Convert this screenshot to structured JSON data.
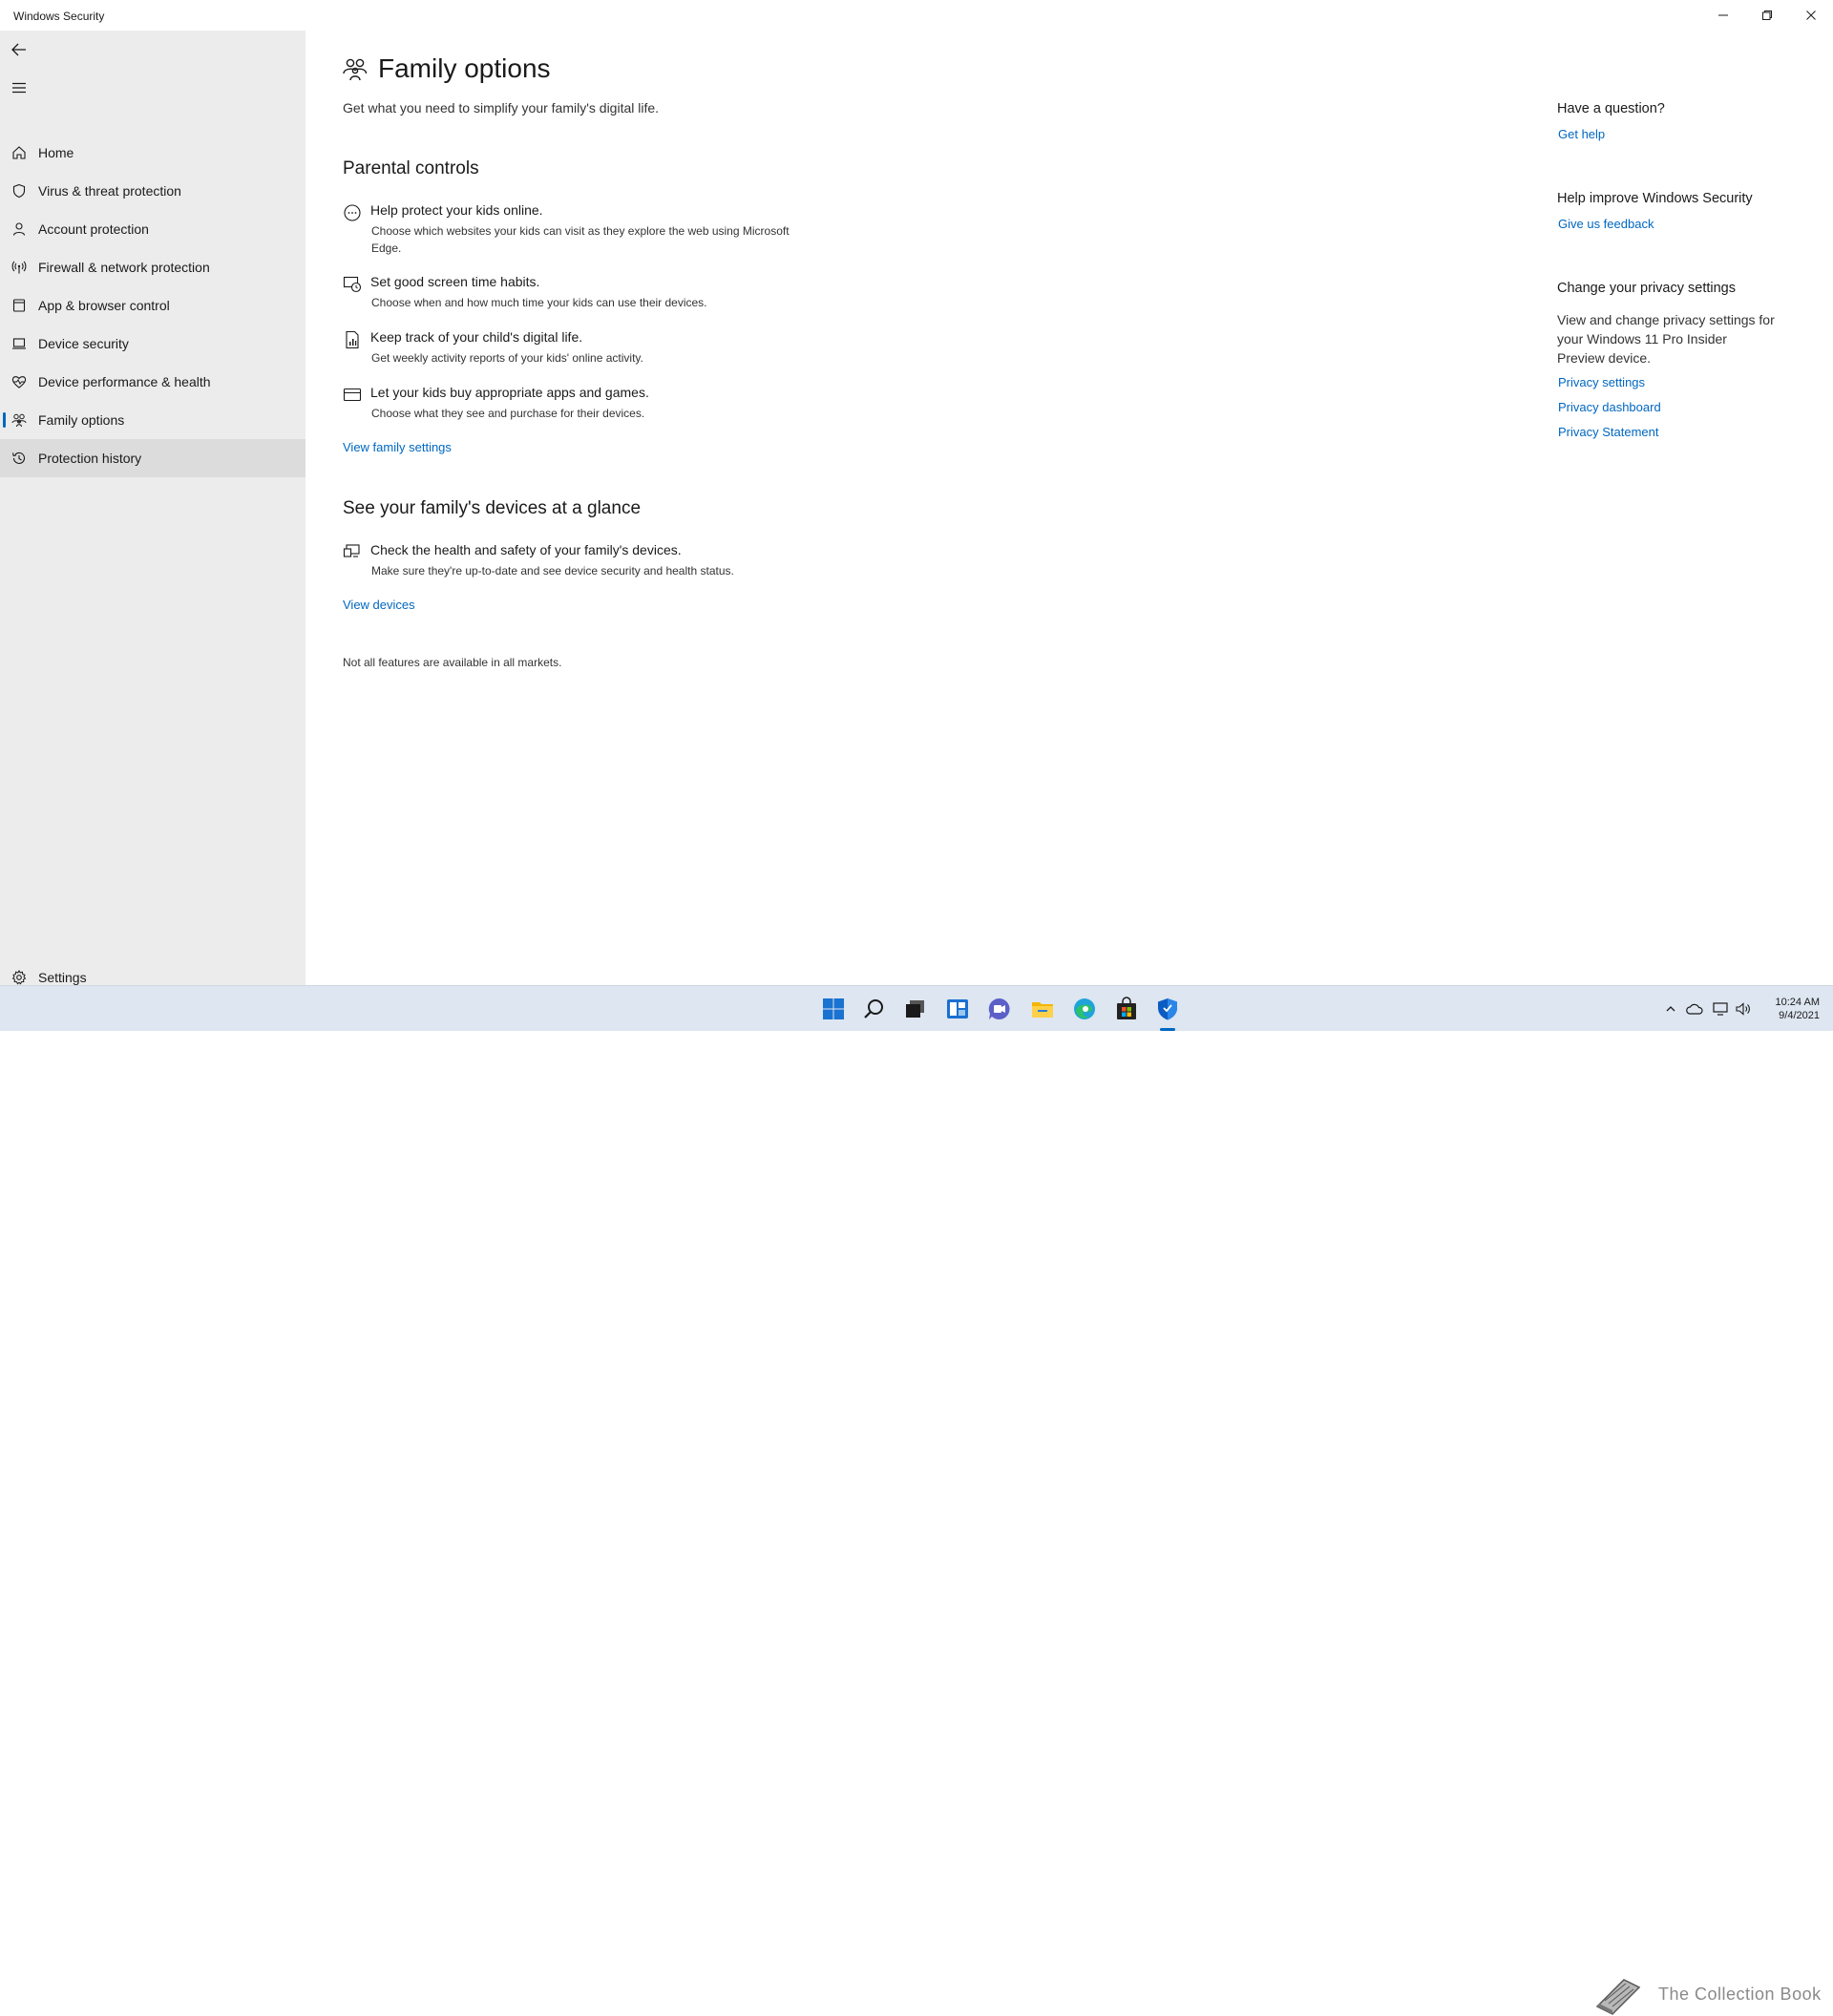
{
  "window": {
    "title": "Windows Security"
  },
  "sidebar": {
    "items": [
      {
        "label": "Home",
        "icon": "home-icon"
      },
      {
        "label": "Virus & threat protection",
        "icon": "shield-icon"
      },
      {
        "label": "Account protection",
        "icon": "person-icon"
      },
      {
        "label": "Firewall & network protection",
        "icon": "antenna-icon"
      },
      {
        "label": "App & browser control",
        "icon": "app-window-icon"
      },
      {
        "label": "Device security",
        "icon": "laptop-icon"
      },
      {
        "label": "Device performance & health",
        "icon": "heart-pulse-icon"
      },
      {
        "label": "Family options",
        "icon": "family-icon",
        "active": true
      },
      {
        "label": "Protection history",
        "icon": "history-icon"
      }
    ],
    "settings_label": "Settings"
  },
  "main": {
    "title": "Family options",
    "subtitle": "Get what you need to simplify your family's digital life.",
    "parental": {
      "heading": "Parental controls",
      "features": [
        {
          "title": "Help protect your kids online.",
          "desc": "Choose which websites your kids can visit as they explore the web using Microsoft Edge."
        },
        {
          "title": "Set good screen time habits.",
          "desc": "Choose when and how much time your kids can use their devices."
        },
        {
          "title": "Keep track of your child's digital life.",
          "desc": "Get weekly activity reports of your kids' online activity."
        },
        {
          "title": "Let your kids buy appropriate apps and games.",
          "desc": "Choose what they see and purchase for their devices."
        }
      ],
      "link": "View family settings"
    },
    "devices": {
      "heading": "See your family's devices at a glance",
      "feature": {
        "title": "Check the health and safety of your family's devices.",
        "desc": "Make sure they're up-to-date and see device security and health status."
      },
      "link": "View devices"
    },
    "note": "Not all features are available in all markets."
  },
  "right_panel": {
    "question": {
      "heading": "Have a question?",
      "link": "Get help"
    },
    "improve": {
      "heading": "Help improve Windows Security",
      "link": "Give us feedback"
    },
    "privacy": {
      "heading": "Change your privacy settings",
      "text": "View and change privacy settings for your Windows 11 Pro Insider Preview device.",
      "links": [
        "Privacy settings",
        "Privacy dashboard",
        "Privacy Statement"
      ]
    }
  },
  "taskbar": {
    "apps": [
      "start-icon",
      "search-icon",
      "task-view-icon",
      "widgets-icon",
      "chat-icon",
      "file-explorer-icon",
      "edge-icon",
      "store-icon",
      "windows-security-icon"
    ],
    "time": "10:24 AM",
    "date": "9/4/2021"
  },
  "watermark": {
    "text": "The Collection Book"
  },
  "colors": {
    "accent": "#0067c0",
    "sidebar_bg": "#ececec",
    "taskbar_bg": "#dde6f1"
  }
}
